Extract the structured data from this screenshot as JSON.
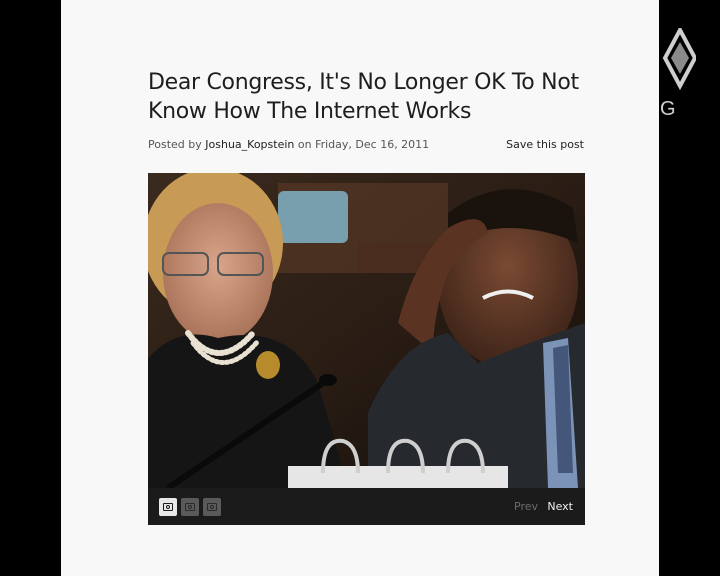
{
  "article": {
    "title": "Dear Congress, It's No Longer OK To Not Know How The Internet Works",
    "byline_prefix": "Posted by ",
    "author": "Joshua_Kopstein",
    "byline_mid": " on ",
    "date": "Friday, Dec 16, 2011",
    "save_label": "Save this post"
  },
  "gallery": {
    "thumb_icon": "camera-icon",
    "thumb_count": 3,
    "active_index": 0,
    "prev_label": "Prev",
    "next_label": "Next"
  },
  "logo": {
    "text": "G",
    "icon": "diamond-logo-icon"
  },
  "colors": {
    "page_bg": "#f8f8f8",
    "outer_bg": "#000000",
    "gallery_bar": "#1b1b1b",
    "title_text": "#1e1e1e"
  }
}
